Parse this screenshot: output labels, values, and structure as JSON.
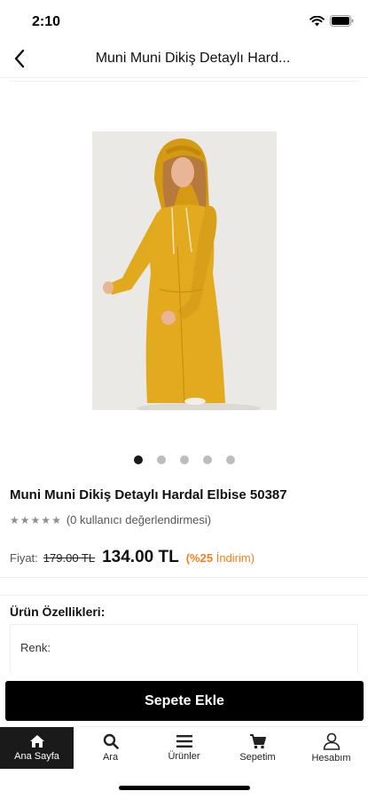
{
  "status_bar": {
    "time": "2:10"
  },
  "header": {
    "title": "Muni Muni Dikiş Detaylı Hard..."
  },
  "carousel": {
    "dot_count": 5,
    "active_index": 0
  },
  "product": {
    "name": "Muni Muni Dikiş Detaylı Hardal Elbise 50387",
    "rating_text": "(0 kullanıcı değerlendirmesi)",
    "rating_stars": 0,
    "price_label": "Fiyat:",
    "old_price": "179.00 TL",
    "new_price": "134.00 TL",
    "discount_percent": "(%25",
    "discount_suffix": "İndirim)"
  },
  "features": {
    "title": "Ürün Özellikleri:",
    "color_label": "Renk:"
  },
  "cart_button": {
    "label": "Sepete Ekle"
  },
  "tab_bar": {
    "items": [
      {
        "label": "Ana Sayfa",
        "icon": "home-icon",
        "active": true
      },
      {
        "label": "Ara",
        "icon": "search-icon",
        "active": false
      },
      {
        "label": "Ürünler",
        "icon": "menu-icon",
        "active": false
      },
      {
        "label": "Sepetim",
        "icon": "cart-icon",
        "active": false
      },
      {
        "label": "Hesabım",
        "icon": "user-icon",
        "active": false
      }
    ]
  },
  "colors": {
    "accent_discount": "#f5801f",
    "button_bg": "#000000",
    "active_tab_bg": "#1a1a1a",
    "dress": "#e0a81c"
  }
}
